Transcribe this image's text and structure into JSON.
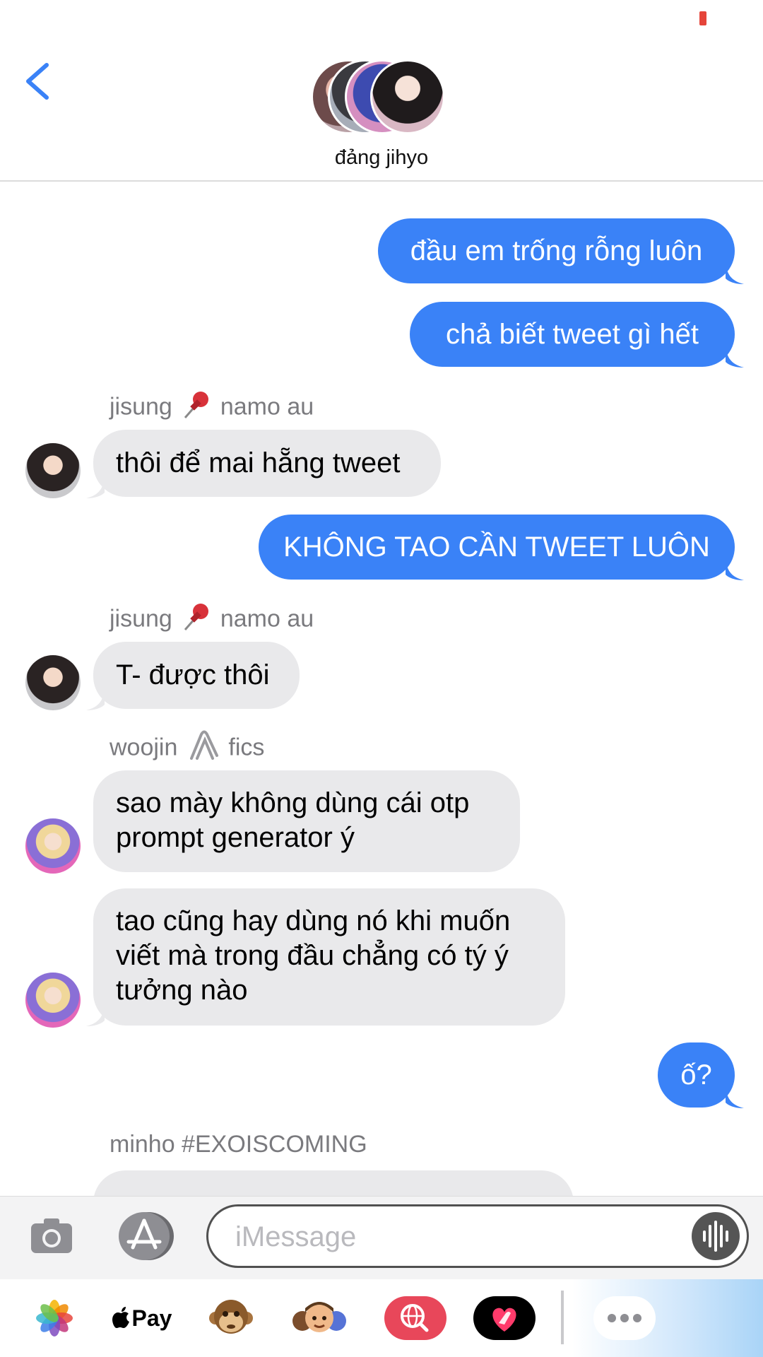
{
  "header": {
    "group_name": "đảng jihyo",
    "back_icon": "chevron-left-icon"
  },
  "messages": {
    "m1": "đầu em trống rỗng luôn",
    "m2": "chả biết tweet gì hết",
    "sender1_name": "jisung",
    "sender1_suffix": "namo au",
    "m3": "thôi để mai hẵng tweet",
    "m4": "KHÔNG TAO CẦN TWEET LUÔN",
    "sender2_name": "jisung",
    "sender2_suffix": "namo au",
    "m5": "T- được thôi",
    "sender3_name": "woojin",
    "sender3_suffix": "fics",
    "m6": "sao mày không dùng cái otp prompt generator ý",
    "m7": "tao cũng hay dùng nó khi muốn viết mà trong đầu chẳng có tý ý tưởng nào",
    "m8": "ố?",
    "sender4_name": "minho #EXOISCOMING"
  },
  "composer": {
    "placeholder": "iMessage",
    "value": ""
  },
  "apps": {
    "pay_label": "Pay"
  },
  "colors": {
    "outgoing": "#3a82f7",
    "incoming": "#e9e9eb",
    "accent": "#3a82f7"
  }
}
